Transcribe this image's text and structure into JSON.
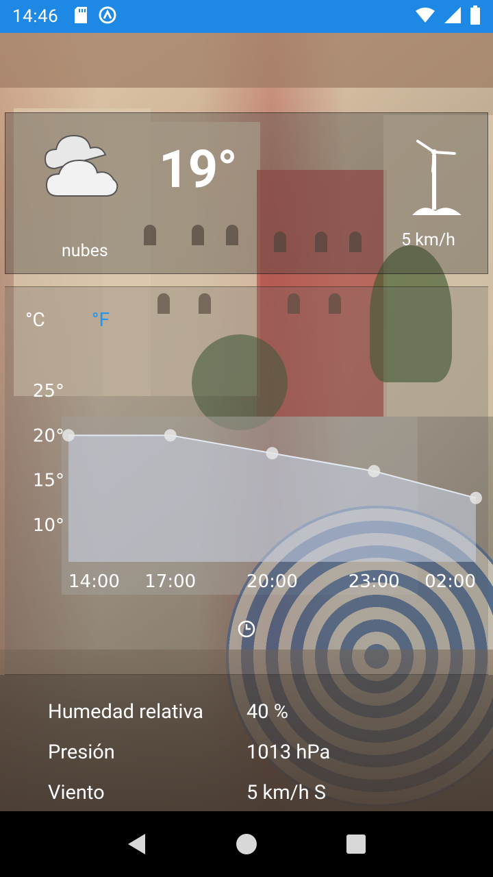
{
  "status_bar": {
    "time": "14:46",
    "left_icons": [
      "sd-card-icon",
      "sync-icon"
    ],
    "right_icons": [
      "wifi-icon",
      "signal-icon",
      "battery-icon"
    ]
  },
  "current": {
    "icon": "cloud-icon",
    "temperature": "19°",
    "description": "nubes",
    "wind_icon": "wind-turbine-icon",
    "wind_speed": "5 km/h"
  },
  "units": {
    "celsius": "°C",
    "fahrenheit": "°F",
    "active_color": "#2196f3"
  },
  "chart_data": {
    "type": "area",
    "x": [
      "14:00",
      "17:00",
      "20:00",
      "23:00",
      "02:00"
    ],
    "values": [
      20,
      20,
      18,
      16,
      13
    ],
    "y_ticks": [
      "25°",
      "20°",
      "15°",
      "10°"
    ],
    "ylim": [
      8,
      26
    ],
    "grid": false,
    "fill_color": "#c9d4e8"
  },
  "details": [
    {
      "label": "Humedad relativa",
      "value": "40 %"
    },
    {
      "label": "Presión",
      "value": "1013 hPa"
    },
    {
      "label": "Viento",
      "value": "5 km/h S"
    }
  ],
  "nav": [
    "back-icon",
    "home-icon",
    "recents-icon"
  ]
}
